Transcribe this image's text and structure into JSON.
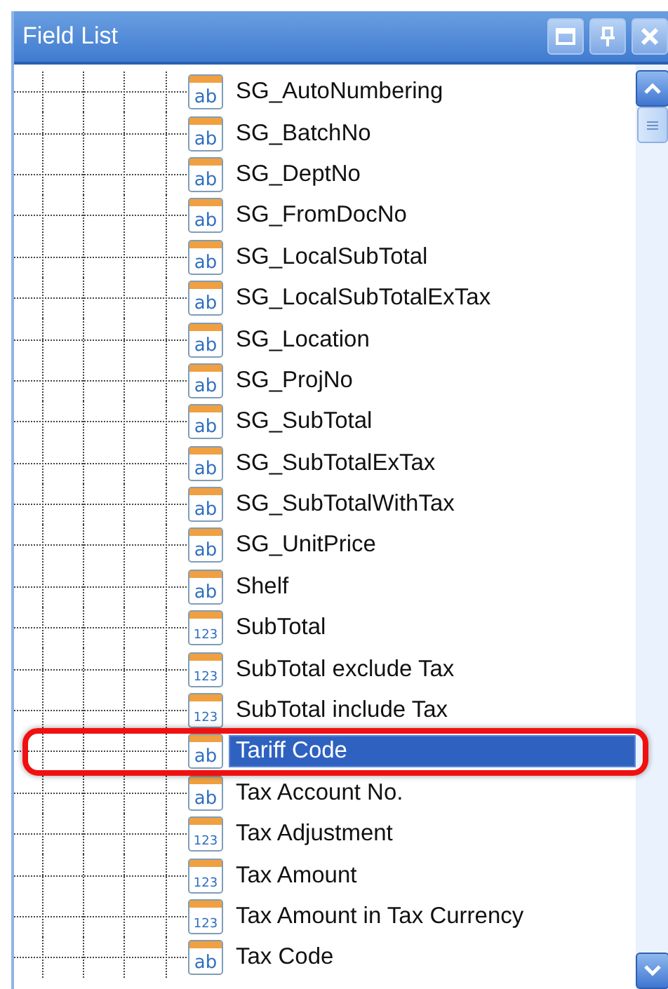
{
  "window": {
    "title": "Field List"
  },
  "fields": [
    {
      "label": "SG_AutoNumbering",
      "badge": "ab",
      "selected": false,
      "highlighted": false
    },
    {
      "label": "SG_BatchNo",
      "badge": "ab",
      "selected": false,
      "highlighted": false
    },
    {
      "label": "SG_DeptNo",
      "badge": "ab",
      "selected": false,
      "highlighted": false
    },
    {
      "label": "SG_FromDocNo",
      "badge": "ab",
      "selected": false,
      "highlighted": false
    },
    {
      "label": "SG_LocalSubTotal",
      "badge": "ab",
      "selected": false,
      "highlighted": false
    },
    {
      "label": "SG_LocalSubTotalExTax",
      "badge": "ab",
      "selected": false,
      "highlighted": false
    },
    {
      "label": "SG_Location",
      "badge": "ab",
      "selected": false,
      "highlighted": false
    },
    {
      "label": "SG_ProjNo",
      "badge": "ab",
      "selected": false,
      "highlighted": false
    },
    {
      "label": "SG_SubTotal",
      "badge": "ab",
      "selected": false,
      "highlighted": false
    },
    {
      "label": "SG_SubTotalExTax",
      "badge": "ab",
      "selected": false,
      "highlighted": false
    },
    {
      "label": "SG_SubTotalWithTax",
      "badge": "ab",
      "selected": false,
      "highlighted": false
    },
    {
      "label": "SG_UnitPrice",
      "badge": "ab",
      "selected": false,
      "highlighted": false
    },
    {
      "label": "Shelf",
      "badge": "ab",
      "selected": false,
      "highlighted": false
    },
    {
      "label": "SubTotal",
      "badge": "123",
      "selected": false,
      "highlighted": false
    },
    {
      "label": "SubTotal exclude Tax",
      "badge": "123",
      "selected": false,
      "highlighted": false
    },
    {
      "label": "SubTotal include Tax",
      "badge": "123",
      "selected": false,
      "highlighted": false
    },
    {
      "label": "Tariff Code",
      "badge": "ab",
      "selected": true,
      "highlighted": true
    },
    {
      "label": "Tax Account No.",
      "badge": "ab",
      "selected": false,
      "highlighted": false
    },
    {
      "label": "Tax Adjustment",
      "badge": "123",
      "selected": false,
      "highlighted": false
    },
    {
      "label": "Tax Amount",
      "badge": "123",
      "selected": false,
      "highlighted": false
    },
    {
      "label": "Tax Amount in Tax Currency",
      "badge": "123",
      "selected": false,
      "highlighted": false
    },
    {
      "label": "Tax Code",
      "badge": "ab",
      "selected": false,
      "highlighted": false
    }
  ]
}
